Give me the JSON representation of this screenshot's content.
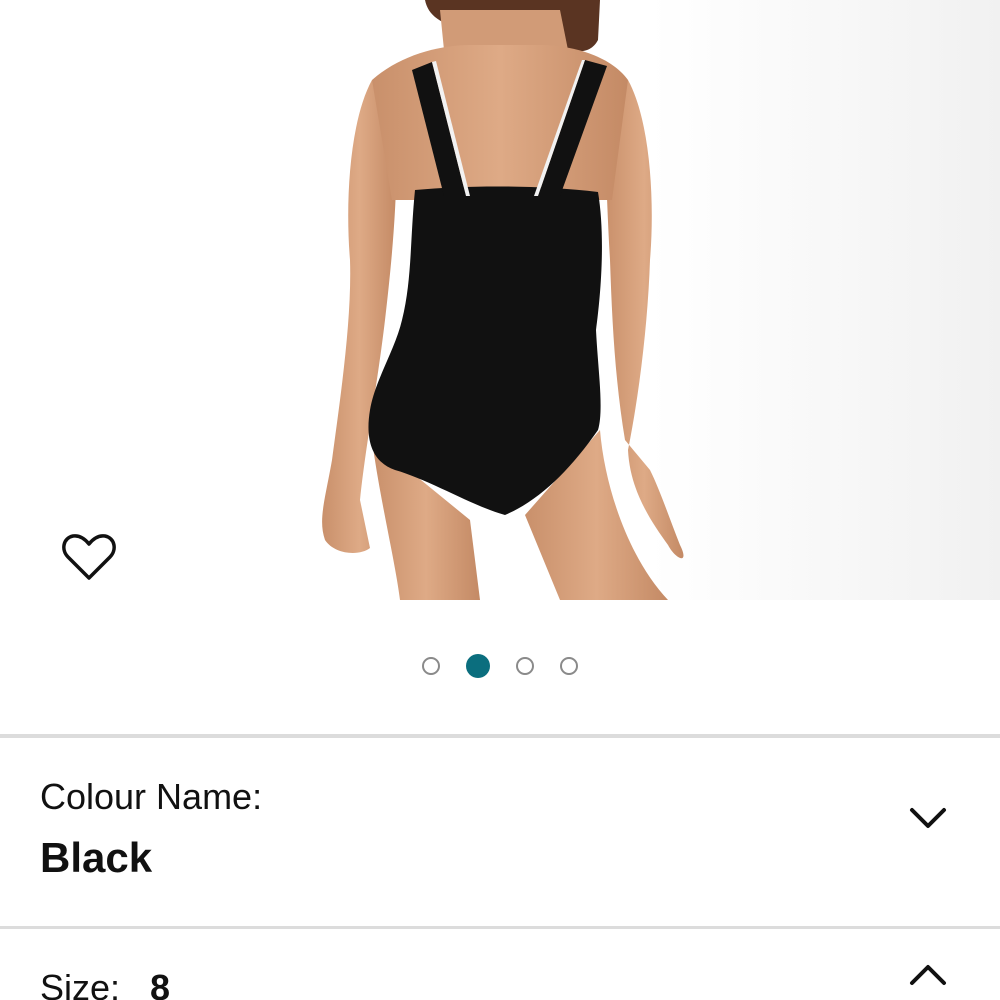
{
  "product_image": {
    "alt": "Back view of model wearing a black one-piece swimsuit with wide straps and white piping",
    "icon": "product-photo"
  },
  "wishlist": {
    "icon": "heart-outline-icon"
  },
  "carousel": {
    "active_index": 1,
    "total": 4,
    "active_color": "#0b6e7e",
    "inactive_color": "#8a8a8a"
  },
  "colour": {
    "label": "Colour Name:",
    "value": "Black",
    "icon": "chevron-down-icon"
  },
  "size": {
    "label": "Size:",
    "value": "8",
    "icon": "chevron-up-icon"
  }
}
